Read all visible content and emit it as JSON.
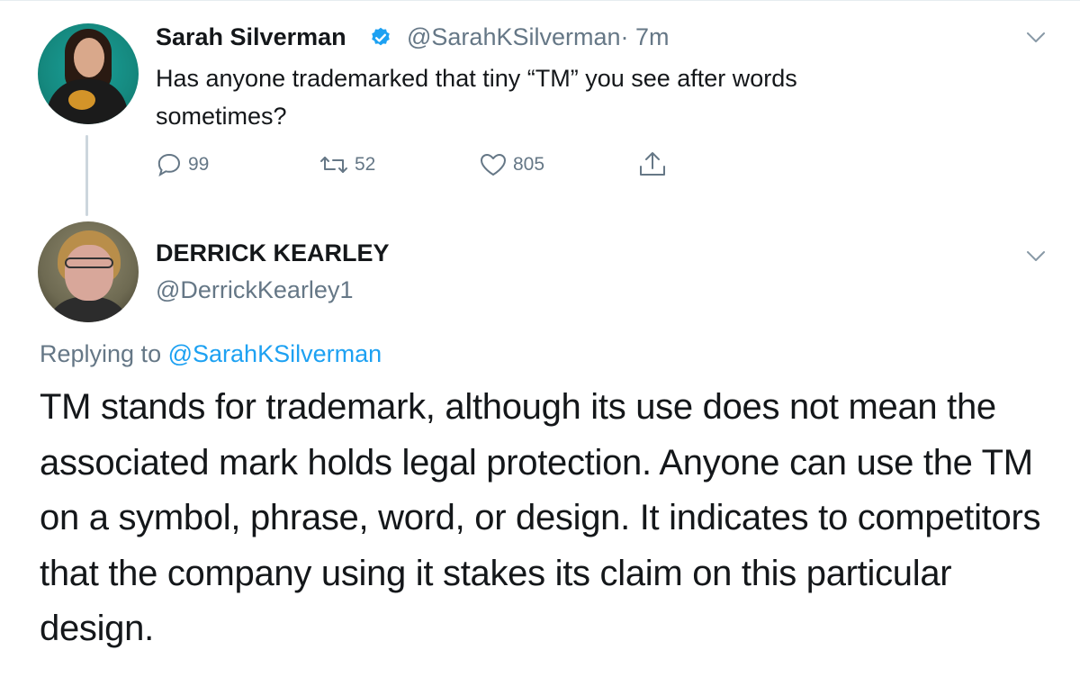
{
  "parent_tweet": {
    "author_name": "Sarah Silverman",
    "handle": "@SarahKSilverman",
    "time": "· 7m",
    "text": "Has anyone trademarked that tiny “TM” you see  after words sometimes?",
    "replies_count": "99",
    "retweets_count": "52",
    "likes_count": "805"
  },
  "reply_tweet": {
    "author_name": "DERRICK KEARLEY",
    "handle": "@DerrickKearley1",
    "replying_prefix": "Replying to",
    "replying_to": "@SarahKSilverman",
    "text": "TM stands for trademark, although its use does not mean the associated mark holds legal protection. Anyone can use the TM on a symbol, phrase, word, or design. It indicates to competitors that the company using it stakes its claim on this particular design."
  },
  "colors": {
    "text_primary": "#14171a",
    "text_secondary": "#657786",
    "link": "#1da1f2",
    "verified": "#1da1f2",
    "divider": "#ccd6dd"
  },
  "icons": {
    "verified": "verified-badge-icon",
    "reply": "reply-icon",
    "retweet": "retweet-icon",
    "like": "heart-icon",
    "share": "share-icon",
    "menu": "chevron-down-icon"
  }
}
